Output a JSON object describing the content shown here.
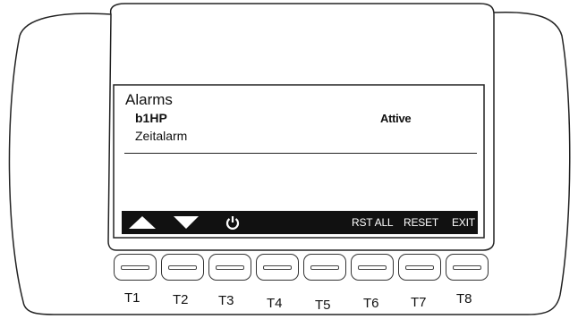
{
  "screen": {
    "title": "Alarms",
    "alarm": {
      "code": "b1HP",
      "status": "Attive",
      "description": "Zeitalarm"
    }
  },
  "softkeys": {
    "up_icon": "triangle-up-icon",
    "down_icon": "triangle-down-icon",
    "power_icon": "power-icon",
    "rst_all": "RST ALL",
    "reset": "RESET",
    "exit": "EXIT"
  },
  "buttons": [
    "T1",
    "T2",
    "T3",
    "T4",
    "T5",
    "T6",
    "T7",
    "T8"
  ]
}
